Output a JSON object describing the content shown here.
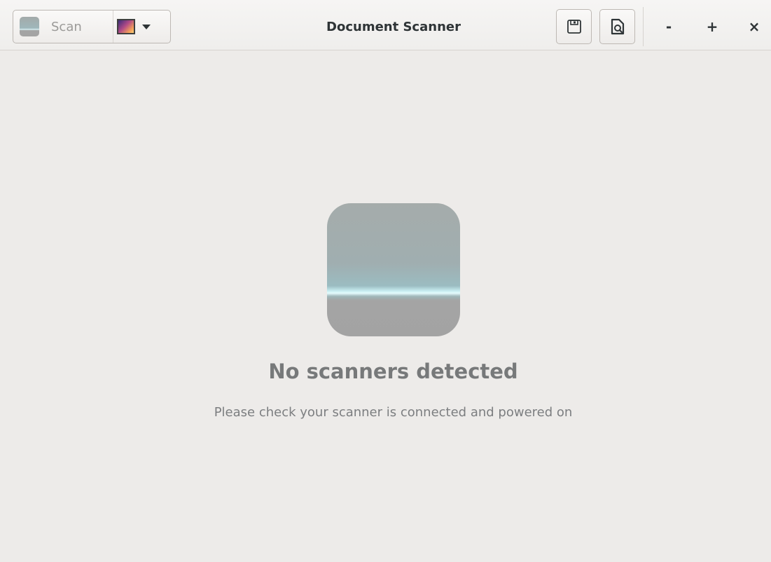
{
  "window": {
    "title": "Document Scanner"
  },
  "toolbar": {
    "scan_label": "Scan",
    "scan_icon": "scanner-icon",
    "scan_type_icon": "photo-icon",
    "dropdown_icon": "chevron-down-icon",
    "save_icon": "save-icon",
    "document_icon": "document-icon"
  },
  "window_controls": {
    "minimize_label": "-",
    "maximize_label": "+",
    "close_label": "×"
  },
  "empty_state": {
    "icon": "scanner-icon",
    "heading": "No scanners detected",
    "message": "Please check your scanner is connected and powered on"
  },
  "colors": {
    "background": "#edebe9",
    "heading_text": "#77797a",
    "message_text": "#7c7e80"
  }
}
